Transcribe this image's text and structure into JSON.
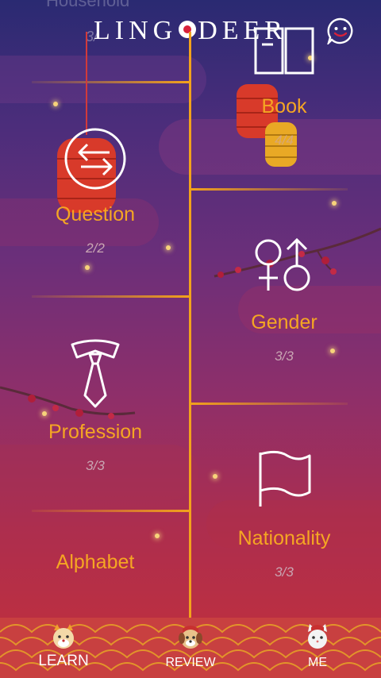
{
  "header": {
    "logo_left": "LING",
    "logo_right": "DEER"
  },
  "ghost_top": {
    "title": "Household",
    "count": "3/"
  },
  "lessons": {
    "book": {
      "title": "Book",
      "count": "4/4"
    },
    "question": {
      "title": "Question",
      "count": "2/2"
    },
    "gender": {
      "title": "Gender",
      "count": "3/3"
    },
    "profession": {
      "title": "Profession",
      "count": "3/3"
    },
    "nationality": {
      "title": "Nationality",
      "count": "3/3"
    },
    "alphabet": {
      "title": "Alphabet"
    }
  },
  "tabs": {
    "learn": "LEARN",
    "review": "REVIEW",
    "me": "ME"
  },
  "colors": {
    "accent": "#f5a623",
    "timeline": "#f2a21c",
    "tabbar": "#c84040"
  }
}
